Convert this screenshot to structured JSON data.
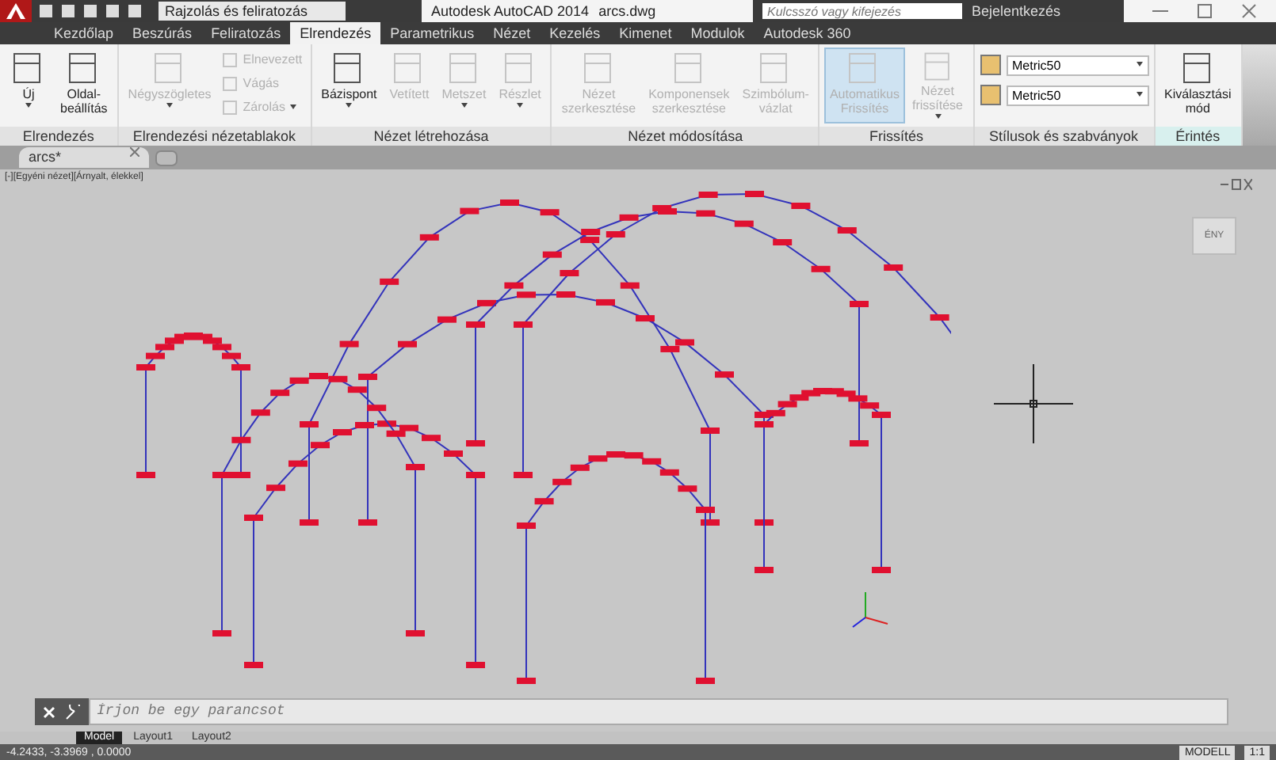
{
  "title_bar": {
    "workspace": "Rajzolás és feliratozás",
    "title": "Autodesk AutoCAD 2014",
    "file": "arcs.dwg",
    "search": {
      "placeholder": "Kulcsszó vagy kifejezés"
    },
    "sign_in": "Bejelentkezés"
  },
  "ribbon_tabs": [
    {
      "label": "Kezdőlap",
      "selected": false
    },
    {
      "label": "Beszúrás",
      "selected": false
    },
    {
      "label": "Feliratozás",
      "selected": false
    },
    {
      "label": "Elrendezés",
      "selected": true
    },
    {
      "label": "Parametrikus",
      "selected": false
    },
    {
      "label": "Nézet",
      "selected": false
    },
    {
      "label": "Kezelés",
      "selected": false
    },
    {
      "label": "Kimenet",
      "selected": false
    },
    {
      "label": "Modulok",
      "selected": false
    },
    {
      "label": "Autodesk 360",
      "selected": false
    }
  ],
  "panels": [
    {
      "title": "Elrendezés",
      "items": [
        {
          "kind": "large",
          "label": "Új",
          "disabled": false,
          "on": false,
          "dropdown": true
        },
        {
          "kind": "large",
          "label": "Oldal-\nbeállítás",
          "disabled": false,
          "on": false,
          "dropdown": false
        }
      ]
    },
    {
      "title": "Elrendezési nézetablakok",
      "items": [
        {
          "kind": "large",
          "label": "Négyszögletes",
          "disabled": true,
          "on": false,
          "dropdown": true
        },
        {
          "kind": "small",
          "label": "Elnevezett",
          "disabled": true,
          "on": false,
          "dropdown": false
        },
        {
          "kind": "small",
          "label": "Vágás",
          "disabled": true,
          "on": false,
          "dropdown": false
        },
        {
          "kind": "small",
          "label": "Zárolás",
          "disabled": true,
          "on": false,
          "dropdown": true
        }
      ]
    },
    {
      "title": "Nézet létrehozása",
      "items": [
        {
          "kind": "large",
          "label": "Bázispont",
          "disabled": false,
          "on": false,
          "dropdown": true
        },
        {
          "kind": "large",
          "label": "Vetített",
          "disabled": true,
          "on": false,
          "dropdown": false
        },
        {
          "kind": "large",
          "label": "Metszet",
          "disabled": true,
          "on": false,
          "dropdown": true
        },
        {
          "kind": "large",
          "label": "Részlet",
          "disabled": true,
          "on": false,
          "dropdown": true
        }
      ]
    },
    {
      "title": "Nézet módosítása",
      "items": [
        {
          "kind": "large",
          "label": "Nézet\nszerkesztése",
          "disabled": true,
          "on": false,
          "dropdown": false
        },
        {
          "kind": "large",
          "label": "Komponensek\nszerkesztése",
          "disabled": true,
          "on": false,
          "dropdown": false
        },
        {
          "kind": "large",
          "label": "Szimbólum-\nvázlat",
          "disabled": true,
          "on": false,
          "dropdown": false
        }
      ]
    },
    {
      "title": "Frissítés",
      "items": [
        {
          "kind": "large",
          "label": "Automatikus\nFrissítés",
          "disabled": true,
          "on": true,
          "dropdown": false
        },
        {
          "kind": "large",
          "label": "Nézet\nfrissítése",
          "disabled": true,
          "on": false,
          "dropdown": true
        }
      ]
    },
    {
      "title": "Stílusok és szabványok",
      "items": [
        {
          "kind": "combo",
          "label": "Metric50",
          "disabled": false,
          "on": false,
          "dropdown": true
        },
        {
          "kind": "combo",
          "label": "Metric50",
          "disabled": false,
          "on": false,
          "dropdown": true
        }
      ]
    },
    {
      "title": "Érintés",
      "items": [
        {
          "kind": "large",
          "label": "Kiválasztási\nmód",
          "disabled": false,
          "on": false,
          "dropdown": false
        }
      ]
    }
  ],
  "doc_tabs": [
    {
      "label": "arcs*",
      "selected": true
    }
  ],
  "viewport": {
    "label": "[-][Egyéni nézet][Árnyalt, élekkel]",
    "viewcube_label": "ÉNY"
  },
  "command_line": {
    "placeholder": "Írjon be egy parancsot"
  },
  "layout_tabs": [
    {
      "label": "Model",
      "selected": true
    },
    {
      "label": "Layout1",
      "selected": false
    },
    {
      "label": "Layout2",
      "selected": false
    }
  ],
  "status_bar": {
    "coordinates": "-4.2433, -3.3969 , 0.0000",
    "space": "MODELL",
    "scale": "1:1"
  }
}
